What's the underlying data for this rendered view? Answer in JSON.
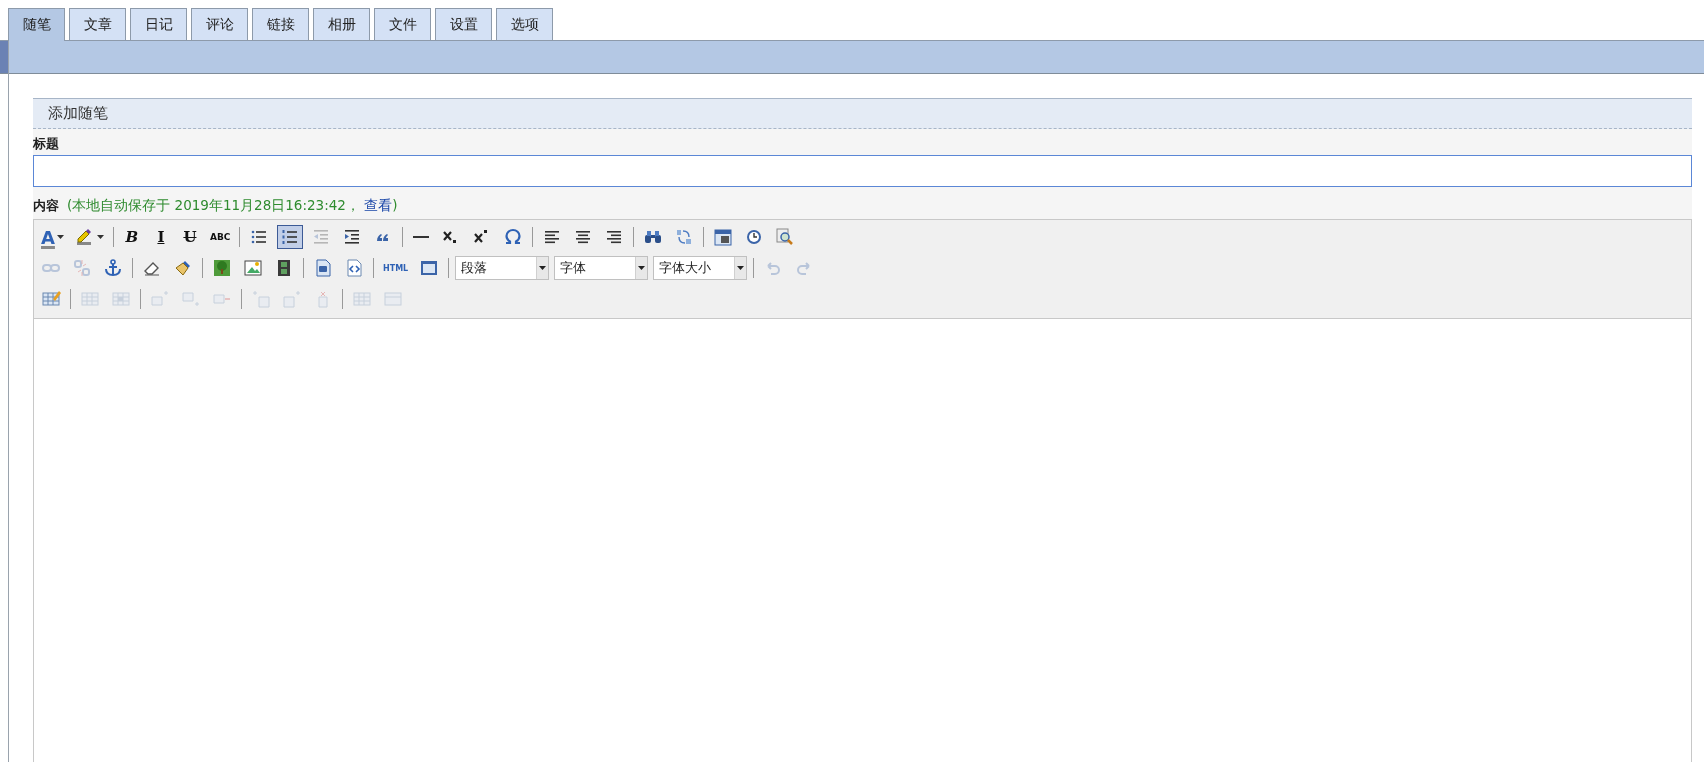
{
  "tabs": [
    {
      "label": "随笔",
      "selected": true
    },
    {
      "label": "文章",
      "selected": false
    },
    {
      "label": "日记",
      "selected": false
    },
    {
      "label": "评论",
      "selected": false
    },
    {
      "label": "链接",
      "selected": false
    },
    {
      "label": "相册",
      "selected": false
    },
    {
      "label": "文件",
      "selected": false
    },
    {
      "label": "设置",
      "selected": false
    },
    {
      "label": "选项",
      "selected": false
    }
  ],
  "section": {
    "title": "添加随笔"
  },
  "title_field": {
    "label": "标题"
  },
  "content": {
    "label": "内容",
    "autosave": "(本地自动保存于 2019年11月28日16:23:42，",
    "view_link": "查看",
    "autosave_end": ")"
  },
  "toolbar": {
    "rows": [
      [
        {
          "kind": "split",
          "label": "A",
          "selected": false,
          "disabled": false
        },
        {
          "kind": "split",
          "selected": false,
          "disabled": false
        },
        {
          "kind": "separator"
        },
        {
          "kind": "button",
          "label": "B",
          "selected": false,
          "disabled": false
        },
        {
          "kind": "button",
          "label": "I",
          "selected": false,
          "disabled": false
        },
        {
          "kind": "button",
          "label": "U",
          "selected": false,
          "disabled": false
        },
        {
          "kind": "button",
          "label": "ABC",
          "selected": false,
          "disabled": false
        },
        {
          "kind": "separator"
        },
        {
          "kind": "button",
          "selected": false,
          "disabled": false
        },
        {
          "kind": "button",
          "selected": true,
          "disabled": false
        },
        {
          "kind": "button",
          "selected": false,
          "disabled": true
        },
        {
          "kind": "button",
          "selected": false,
          "disabled": false
        },
        {
          "kind": "button",
          "selected": false,
          "disabled": false
        },
        {
          "kind": "separator"
        },
        {
          "kind": "button",
          "selected": false,
          "disabled": false
        },
        {
          "kind": "button",
          "selected": false,
          "disabled": false
        },
        {
          "kind": "button",
          "selected": false,
          "disabled": false
        },
        {
          "kind": "button",
          "selected": false,
          "disabled": false
        },
        {
          "kind": "separator"
        },
        {
          "kind": "button",
          "selected": false,
          "disabled": false
        },
        {
          "kind": "button",
          "selected": false,
          "disabled": false
        },
        {
          "kind": "button",
          "selected": false,
          "disabled": false
        },
        {
          "kind": "separator"
        },
        {
          "kind": "button",
          "selected": false,
          "disabled": false
        },
        {
          "kind": "button",
          "selected": false,
          "disabled": false
        },
        {
          "kind": "separator"
        },
        {
          "kind": "button",
          "selected": false,
          "disabled": false
        },
        {
          "kind": "button",
          "selected": false,
          "disabled": false
        },
        {
          "kind": "button",
          "selected": false,
          "disabled": false
        }
      ],
      [
        {
          "kind": "button",
          "selected": false,
          "disabled": true
        },
        {
          "kind": "button",
          "selected": false,
          "disabled": true
        },
        {
          "kind": "button",
          "selected": false,
          "disabled": false
        },
        {
          "kind": "separator"
        },
        {
          "kind": "button",
          "selected": false,
          "disabled": false
        },
        {
          "kind": "button",
          "selected": false,
          "disabled": false
        },
        {
          "kind": "separator"
        },
        {
          "kind": "button",
          "selected": false,
          "disabled": false
        },
        {
          "kind": "button",
          "selected": false,
          "disabled": false
        },
        {
          "kind": "button",
          "selected": false,
          "disabled": false
        },
        {
          "kind": "separator"
        },
        {
          "kind": "button",
          "selected": false,
          "disabled": false
        },
        {
          "kind": "button",
          "selected": false,
          "disabled": false
        },
        {
          "kind": "separator"
        },
        {
          "kind": "button",
          "label": "HTML",
          "selected": false,
          "disabled": false
        },
        {
          "kind": "button",
          "selected": false,
          "disabled": false
        },
        {
          "kind": "separator"
        },
        {
          "kind": "select",
          "value": "段落"
        },
        {
          "kind": "select",
          "value": "字体"
        },
        {
          "kind": "select",
          "value": "字体大小"
        },
        {
          "kind": "separator"
        },
        {
          "kind": "button",
          "selected": false,
          "disabled": true
        },
        {
          "kind": "button",
          "selected": false,
          "disabled": true
        }
      ],
      [
        {
          "kind": "button",
          "selected": false,
          "disabled": false
        },
        {
          "kind": "separator"
        },
        {
          "kind": "button",
          "selected": false,
          "disabled": true
        },
        {
          "kind": "button",
          "selected": false,
          "disabled": true
        },
        {
          "kind": "separator"
        },
        {
          "kind": "button",
          "selected": false,
          "disabled": true
        },
        {
          "kind": "button",
          "selected": false,
          "disabled": true
        },
        {
          "kind": "button",
          "selected": false,
          "disabled": true
        },
        {
          "kind": "separator"
        },
        {
          "kind": "button",
          "selected": false,
          "disabled": true
        },
        {
          "kind": "button",
          "selected": false,
          "disabled": true
        },
        {
          "kind": "button",
          "selected": false,
          "disabled": true
        },
        {
          "kind": "separator"
        },
        {
          "kind": "button",
          "selected": false,
          "disabled": true
        },
        {
          "kind": "button",
          "selected": false,
          "disabled": true
        }
      ]
    ]
  }
}
